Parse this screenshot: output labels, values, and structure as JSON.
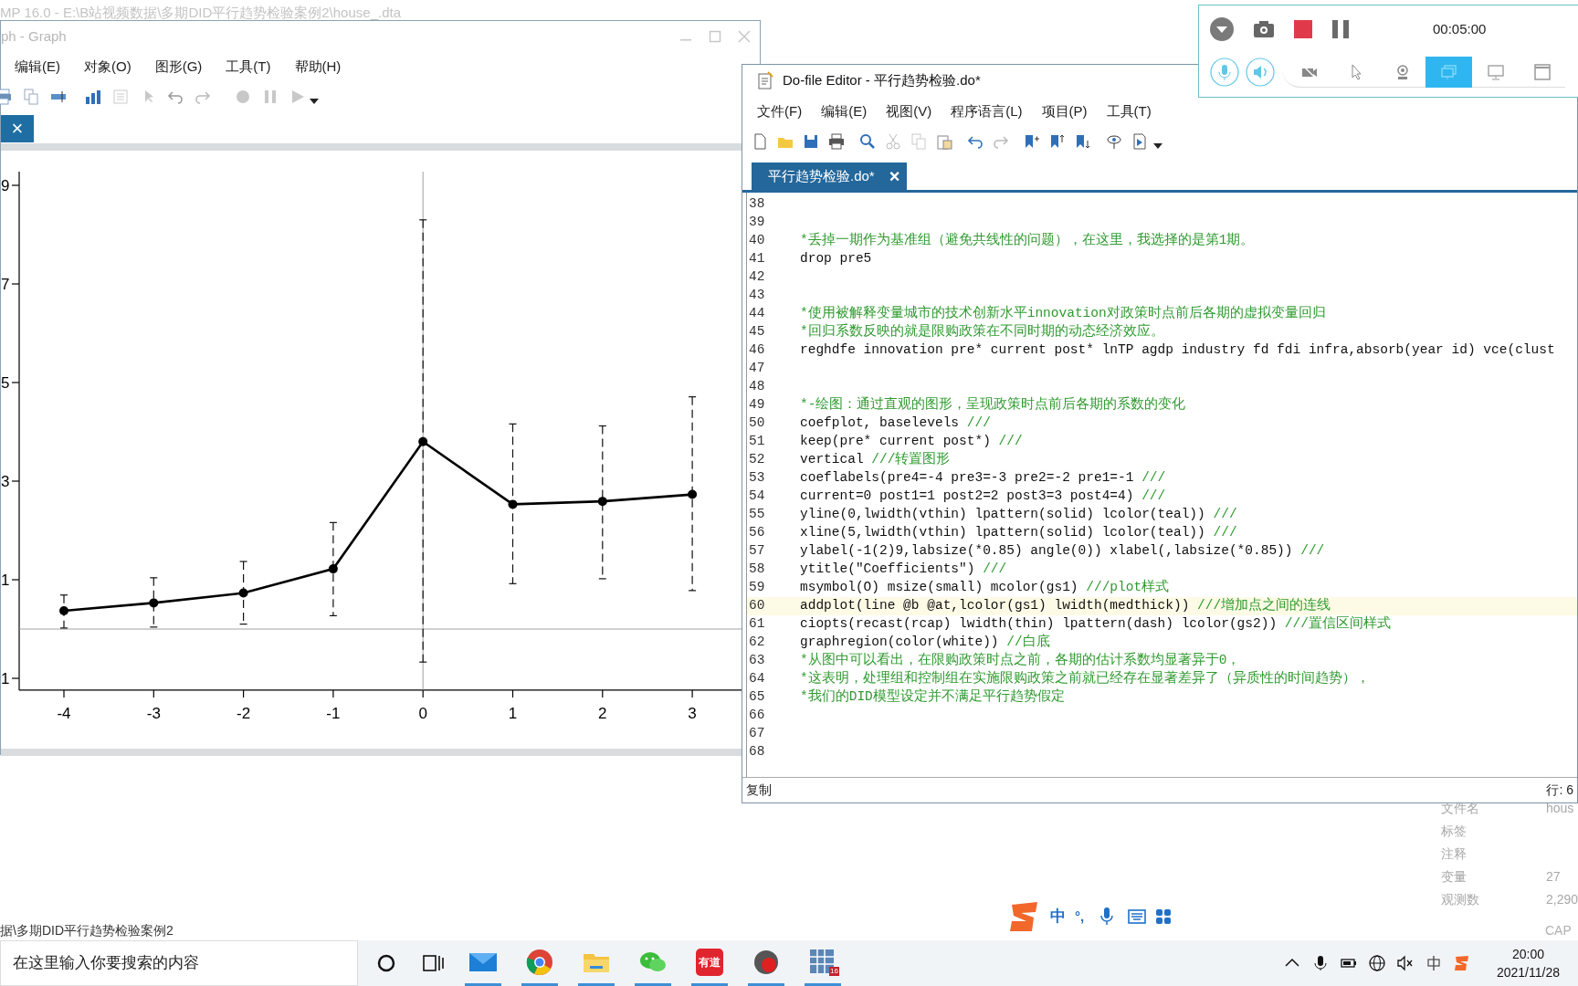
{
  "background_window": {
    "title": "MP 16.0 - E:\\B站视频数据\\多期DID平行趋势检验案例2\\house_.dta",
    "status_path": "据\\多期DID平行趋势检验案例2",
    "indicator": "CAP",
    "properties": [
      {
        "label": "文件名",
        "value": "hous"
      },
      {
        "label": "标签"
      },
      {
        "label": "注释"
      },
      {
        "label": "变量",
        "value": "27"
      },
      {
        "label": "观测数",
        "value": "2,290"
      }
    ]
  },
  "graph_window": {
    "title": "ph - Graph",
    "menu": [
      "编辑(E)",
      "对象(O)",
      "图形(G)",
      "工具(T)",
      "帮助(H)"
    ],
    "tab_close": "×",
    "chart_data": {
      "type": "line",
      "categories": [
        "-4",
        "-3",
        "-2",
        "-1",
        "0",
        "1",
        "2",
        "3"
      ],
      "series": [
        {
          "color": "#000000",
          "marker": true,
          "values": [
            0.37,
            0.53,
            0.73,
            1.22,
            3.8,
            2.53,
            2.59,
            2.73
          ],
          "errors": [
            [
              0.02,
              0.69
            ],
            [
              0.04,
              1.04
            ],
            [
              0.1,
              1.37
            ],
            [
              0.27,
              2.16
            ],
            [
              -0.67,
              8.3
            ],
            [
              0.92,
              4.16
            ],
            [
              1.02,
              4.12
            ],
            [
              0.78,
              4.71
            ]
          ]
        }
      ],
      "ylim": [
        -1.24,
        9.28
      ],
      "yticks": [
        {
          "value": 9,
          "label": "9"
        },
        {
          "value": 7,
          "label": "7"
        },
        {
          "value": 5,
          "label": "5"
        },
        {
          "value": 3,
          "label": "3"
        },
        {
          "value": 1,
          "label": "1"
        },
        {
          "value": -1,
          "label": "1"
        }
      ],
      "ref_lines": [
        {
          "axis": "y",
          "value": 0
        },
        {
          "axis": "x",
          "value": "0"
        }
      ]
    }
  },
  "dofile_editor": {
    "title": "Do-file Editor - 平行趋势检验.do*",
    "menu": [
      "文件(F)",
      "编辑(E)",
      "视图(V)",
      "程序语言(L)",
      "项目(P)",
      "工具(T)"
    ],
    "tab": {
      "label": "平行趋势检验.do*",
      "close": "×"
    },
    "lines": [
      {
        "num": "38",
        "highlighted": false
      },
      {
        "num": "39",
        "highlighted": false
      },
      {
        "num": "40",
        "comment": "*丢掉一期作为基准组（避免共线性的问题），在这里，我选择的是第1期。",
        "highlighted": false
      },
      {
        "num": "41",
        "code": "drop pre5",
        "highlighted": false
      },
      {
        "num": "42",
        "highlighted": false
      },
      {
        "num": "43",
        "highlighted": false
      },
      {
        "num": "44",
        "comment": "*使用被解释变量城市的技术创新水平innovation对政策时点前后各期的虚拟变量回归",
        "highlighted": false
      },
      {
        "num": "45",
        "comment": "*回归系数反映的就是限购政策在不同时期的动态经济效应。",
        "highlighted": false
      },
      {
        "num": "46",
        "code": "reghdfe innovation pre* current post* lnTP agdp industry fd fdi infra,absorb(year id) vce(clust",
        "highlighted": false
      },
      {
        "num": "47",
        "highlighted": false
      },
      {
        "num": "48",
        "highlighted": false
      },
      {
        "num": "49",
        "comment": "*-绘图：通过直观的图形，呈现政策时点前后各期的系数的变化",
        "highlighted": false
      },
      {
        "num": "50",
        "code": "coefplot, baselevels ",
        "comment": "///",
        "highlighted": false
      },
      {
        "num": "51",
        "code": "keep(pre* current post*) ",
        "comment": "///",
        "highlighted": false
      },
      {
        "num": "52",
        "code": "vertical ",
        "comment": "///转置图形",
        "highlighted": false
      },
      {
        "num": "53",
        "code": "coeflabels(pre4=-4 pre3=-3 pre2=-2 pre1=-1 ",
        "comment": "///",
        "highlighted": false
      },
      {
        "num": "54",
        "code": "current=0 post1=1 post2=2 post3=3 post4=4) ",
        "comment": "///",
        "highlighted": false
      },
      {
        "num": "55",
        "code": "yline(0,lwidth(vthin) lpattern(solid) lcolor(teal)) ",
        "comment": "///",
        "highlighted": false
      },
      {
        "num": "56",
        "code": "xline(5,lwidth(vthin) lpattern(solid) lcolor(teal)) ",
        "comment": "///",
        "highlighted": false
      },
      {
        "num": "57",
        "code": "ylabel(-1(2)9,labsize(*0.85) angle(0)) xlabel(,labsize(*0.85)) ",
        "comment": "///",
        "highlighted": false
      },
      {
        "num": "58",
        "code": "ytitle(\"Coefficients\") ",
        "comment": "///",
        "highlighted": false
      },
      {
        "num": "59",
        "code": "msymbol(O) msize(small) mcolor(gs1) ",
        "comment": "///plot样式",
        "highlighted": false
      },
      {
        "num": "60",
        "code": "addplot(line @b @at,lcolor(gs1) lwidth(medthick)) ",
        "comment": "///增加点之间的连线",
        "highlighted": true
      },
      {
        "num": "61",
        "code": "ciopts(recast(rcap) lwidth(thin) lpattern(dash) lcolor(gs2)) ",
        "comment": "///置信区间样式",
        "highlighted": false
      },
      {
        "num": "62",
        "code": "graphregion(color(white)) ",
        "comment": "//白底",
        "highlighted": false
      },
      {
        "num": "63",
        "comment": "*从图中可以看出，在限购政策时点之前，各期的估计系数均显著异于0，",
        "highlighted": false
      },
      {
        "num": "64",
        "comment": "*这表明，处理组和控制组在实施限购政策之前就已经存在显著差异了（异质性的时间趋势），",
        "highlighted": false
      },
      {
        "num": "65",
        "comment": "*我们的DID模型设定并不满足平行趋势假定",
        "highlighted": false
      },
      {
        "num": "66",
        "highlighted": false
      },
      {
        "num": "67",
        "highlighted": false
      },
      {
        "num": "68",
        "highlighted": false
      }
    ],
    "status_left": "复制",
    "status_right": "行: 6"
  },
  "recorder": {
    "timer": "00:05:00",
    "modes": [
      {
        "kind": "camera-off",
        "selected": false
      },
      {
        "kind": "cursor",
        "selected": false
      },
      {
        "kind": "webcam",
        "selected": false
      },
      {
        "kind": "screen",
        "selected": true
      },
      {
        "kind": "monitor",
        "selected": false
      },
      {
        "kind": "window",
        "selected": false
      }
    ]
  },
  "ime_bar": {
    "mode": "中",
    "punct": "°,"
  },
  "taskbar": {
    "search": {
      "placeholder": "在这里输入你要搜索的内容"
    },
    "apps": [
      {
        "kind": "mail",
        "running": true
      },
      {
        "kind": "chrome",
        "running": true
      },
      {
        "kind": "folder",
        "running": true
      },
      {
        "kind": "wechat",
        "running": true
      },
      {
        "kind": "youdao",
        "label": "有道",
        "running": true
      },
      {
        "kind": "recorder",
        "running": true
      },
      {
        "kind": "stata",
        "badge": "16",
        "running": true
      }
    ],
    "time": "20:00",
    "date": "2021/11/28"
  }
}
